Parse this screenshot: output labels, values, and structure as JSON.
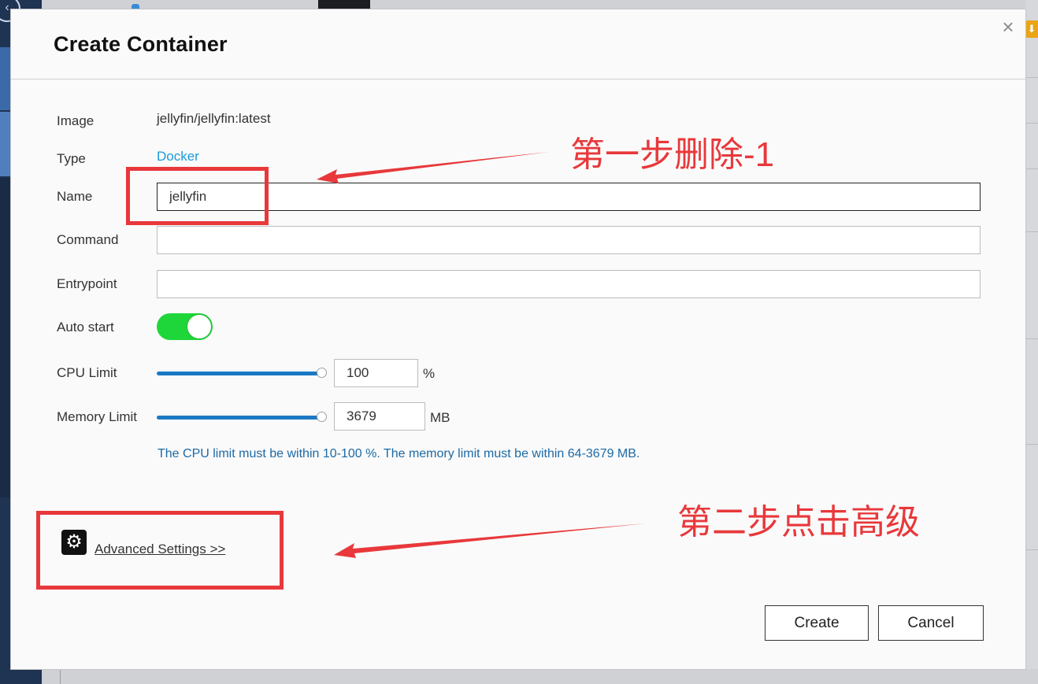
{
  "modal": {
    "title": "Create Container",
    "close_glyph": "×"
  },
  "form": {
    "image_label": "Image",
    "image_value": "jellyfin/jellyfin:latest",
    "type_label": "Type",
    "type_value": "Docker",
    "name_label": "Name",
    "name_value": "jellyfin",
    "command_label": "Command",
    "command_value": "",
    "entrypoint_label": "Entrypoint",
    "entrypoint_value": "",
    "autostart_label": "Auto start",
    "autostart_on": true,
    "cpu_label": "CPU Limit",
    "cpu_value": "100",
    "cpu_unit": "%",
    "cpu_slider_fraction": 1.0,
    "memory_label": "Memory Limit",
    "memory_value": "3679",
    "memory_unit": "MB",
    "memory_slider_fraction": 1.0,
    "hint": "The CPU limit must be within 10-100 %. The memory limit must be within 64-3679 MB."
  },
  "advanced": {
    "icon": "gear-icon",
    "link_label": "Advanced Settings >>"
  },
  "buttons": {
    "create_label": "Create",
    "cancel_label": "Cancel"
  },
  "annotations": {
    "step1_text": "第一步删除-1",
    "step2_text": "第二步点击高级"
  },
  "colors": {
    "annotation_red": "#e8383b",
    "toggle_on": "#1fd63a",
    "slider_fill": "#1b78c4",
    "link_blue": "#1a9cd8",
    "hint_blue": "#1c6aa6"
  }
}
